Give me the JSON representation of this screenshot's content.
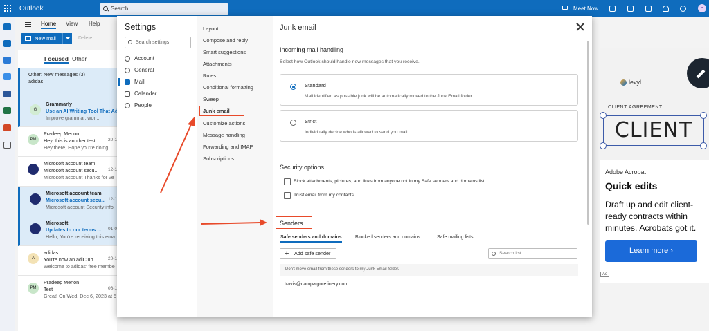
{
  "app": {
    "name": "Outlook"
  },
  "topbar": {
    "search_placeholder": "Search",
    "meet_now": "Meet Now",
    "avatar_initial": "P"
  },
  "ribbon": {
    "tabs": [
      "Home",
      "View",
      "Help"
    ],
    "new_mail": "New mail",
    "delete": "Delete"
  },
  "mail_list": {
    "tabs": [
      "Focused",
      "Other"
    ],
    "items": [
      {
        "sender": "Other: New messages (3)",
        "subject": "adidas",
        "preview": "",
        "date": "",
        "avatar": "",
        "avatar_color": "#ffffff",
        "unread": false,
        "selected": true
      },
      {
        "sender": "Grammarly",
        "subject": "Use an AI Writing Tool That Ad",
        "preview": "Improve grammar, wor...",
        "date": "",
        "avatar": "G",
        "avatar_color": "#d2ecd3",
        "unread": true,
        "selected": true
      },
      {
        "sender": "Pradeep Menon",
        "subject": "Hey, this is another test...",
        "preview": "Hey there, Hope you're doing",
        "date": "20-1",
        "avatar": "PM",
        "avatar_color": "#c8e6c9",
        "unread": false,
        "selected": false
      },
      {
        "sender": "Microsoft account team",
        "subject": "Microsoft account secu...",
        "preview": "Microsoft account Thanks for ve",
        "date": "12-1",
        "avatar": "",
        "avatar_color": "#1f2b6e",
        "unread": false,
        "selected": false
      },
      {
        "sender": "Microsoft account team",
        "subject": "Microsoft account secu...",
        "preview": "Microsoft account Security info",
        "date": "12-1",
        "avatar": "",
        "avatar_color": "#1f2b6e",
        "unread": true,
        "selected": true
      },
      {
        "sender": "Microsoft",
        "subject": "Updates to our terms ...",
        "preview": "Hello, You're receiving this ema",
        "date": "01-0",
        "avatar": "",
        "avatar_color": "#1f2b6e",
        "unread": true,
        "selected": true
      },
      {
        "sender": "adidas",
        "subject": "You're now an adiClub ...",
        "preview": "Welcome to adidas' free membe",
        "date": "20-1",
        "avatar": "A",
        "avatar_color": "#f3e2b5",
        "unread": false,
        "selected": false
      },
      {
        "sender": "Pradeep Menon",
        "subject": "Test",
        "preview": "Great! On Wed, Dec 6, 2023 at 5",
        "date": "06-1",
        "avatar": "PM",
        "avatar_color": "#c8e6c9",
        "unread": false,
        "selected": false
      }
    ]
  },
  "ad": {
    "logo_text": "levyl",
    "agreement": "CLIENT AGREEMENT",
    "hero_word": "CLIENT",
    "brand": "Adobe Acrobat",
    "headline": "Quick edits",
    "body": "Draft up and edit client-ready contracts within minutes. Acrobats got it.",
    "cta": "Learn more ›",
    "badge": "Ad"
  },
  "settings": {
    "title": "Settings",
    "search_placeholder": "Search settings",
    "categories": [
      "Account",
      "General",
      "Mail",
      "Calendar",
      "People"
    ],
    "active_category": "Mail",
    "subcategories": [
      "Layout",
      "Compose and reply",
      "Smart suggestions",
      "Attachments",
      "Rules",
      "Conditional formatting",
      "Sweep",
      "Junk email",
      "Customize actions",
      "Message handling",
      "Forwarding and IMAP",
      "Subscriptions"
    ],
    "active_subcategory": "Junk email"
  },
  "junk": {
    "title": "Junk email",
    "incoming_heading": "Incoming mail handling",
    "incoming_desc": "Select how Outlook should handle new messages that you receive.",
    "standard_label": "Standard",
    "standard_desc": "Mail identified as possible junk will be automatically moved to the Junk Email folder",
    "strict_label": "Strict",
    "strict_desc": "Individually decide who is allowed to send you mail",
    "security_heading": "Security options",
    "block_label": "Block attachments, pictures, and links from anyone not in my Safe senders and domains list",
    "trust_label": "Trust email from my contacts",
    "senders_heading": "Senders",
    "sender_tabs": [
      "Safe senders and domains",
      "Blocked senders and domains",
      "Safe mailing lists"
    ],
    "add_button": "Add safe sender",
    "search_placeholder": "Search list",
    "info_text": "Don't move email from these senders to my Junk Email folder.",
    "entries": [
      "travis@campaignrefinery.com"
    ]
  }
}
